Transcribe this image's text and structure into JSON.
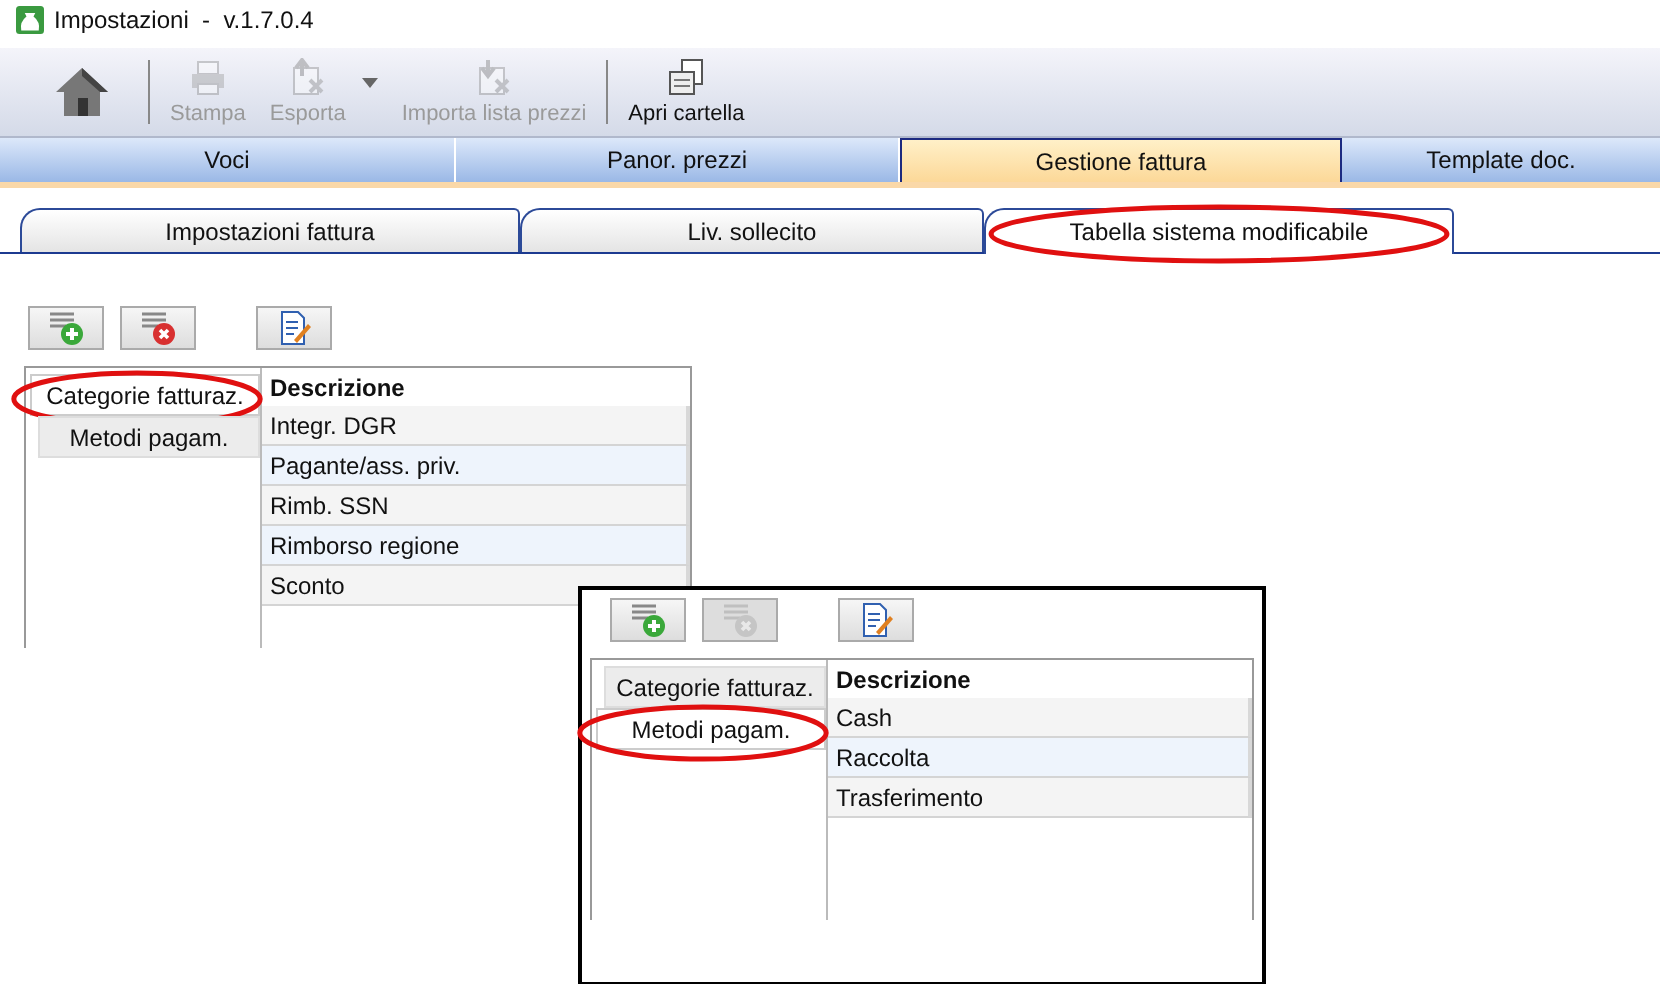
{
  "window": {
    "title": "Impostazioni  -  v.1.7.0.4"
  },
  "toolbar": [
    {
      "kind": "home"
    },
    {
      "kind": "print",
      "label": "Stampa",
      "disabled": true,
      "dropdown": false
    },
    {
      "kind": "export",
      "label": "Esporta",
      "disabled": true,
      "dropdown": true
    },
    {
      "kind": "import",
      "label": "Importa lista prezzi",
      "disabled": true,
      "dropdown": false
    },
    {
      "kind": "folder",
      "label": "Apri cartella",
      "disabled": false,
      "dropdown": false
    }
  ],
  "main_tabs": [
    {
      "label": "Voci",
      "selected": false
    },
    {
      "label": "Panor. prezzi",
      "selected": false
    },
    {
      "label": "Gestione fattura",
      "selected": true
    },
    {
      "label": "Template doc.",
      "selected": false
    }
  ],
  "sub_tabs": [
    {
      "label": "Impostazioni fattura",
      "selected": false,
      "highlighted": false
    },
    {
      "label": "Liv. sollecito",
      "selected": false,
      "highlighted": false
    },
    {
      "label": "Tabella sistema modificabile",
      "selected": true,
      "highlighted": true
    }
  ],
  "panels": [
    {
      "kind": "main",
      "buttons": [
        {
          "kind": "add",
          "disabled": false
        },
        {
          "kind": "delete",
          "disabled": false
        },
        {
          "kind": "edit",
          "disabled": false
        }
      ],
      "categories": [
        {
          "label": "Categorie fatturaz.",
          "selected": true,
          "highlighted": true
        },
        {
          "label": "Metodi pagam.",
          "selected": false,
          "highlighted": false
        }
      ],
      "table": {
        "columns": [
          "Descrizione"
        ],
        "rows": [
          "Integr. DGR",
          "Pagante/ass. priv.",
          "Rimb. SSN",
          "Rimborso regione",
          "Sconto"
        ]
      }
    },
    {
      "kind": "inset",
      "buttons": [
        {
          "kind": "add",
          "disabled": false
        },
        {
          "kind": "delete",
          "disabled": true
        },
        {
          "kind": "edit",
          "disabled": false
        }
      ],
      "categories": [
        {
          "label": "Categorie fatturaz.",
          "selected": false,
          "highlighted": false
        },
        {
          "label": "Metodi pagam.",
          "selected": true,
          "highlighted": true
        }
      ],
      "table": {
        "columns": [
          "Descrizione"
        ],
        "rows": [
          "Cash",
          "Raccolta",
          "Trasferimento"
        ]
      }
    }
  ]
}
